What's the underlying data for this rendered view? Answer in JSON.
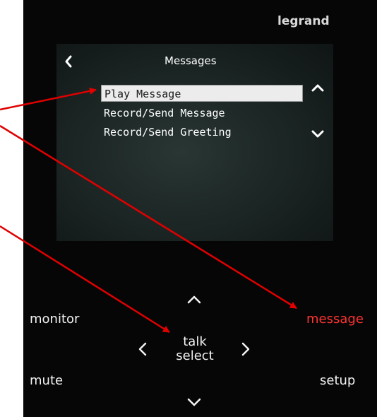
{
  "brand": "legrand",
  "screen": {
    "title": "Messages",
    "menu": [
      {
        "label": "Play Message",
        "selected": true
      },
      {
        "label": "Record/Send Message",
        "selected": false
      },
      {
        "label": "Record/Send Greeting",
        "selected": false
      }
    ]
  },
  "buttons": {
    "monitor": "monitor",
    "message": "message",
    "mute": "mute",
    "setup": "setup",
    "talk": "talk",
    "select": "select"
  },
  "colors": {
    "panel": "#060606",
    "accent": "#ff3333",
    "annotation_arrow": "#e00000",
    "highlight": "#ececec"
  },
  "icons": {
    "screen_back": "chevron-left-icon",
    "scroll_up": "chevron-up-icon",
    "scroll_down": "chevron-down-icon",
    "nav_up": "chevron-up-icon",
    "nav_down": "chevron-down-icon",
    "nav_left": "chevron-left-icon",
    "nav_right": "chevron-right-icon"
  }
}
